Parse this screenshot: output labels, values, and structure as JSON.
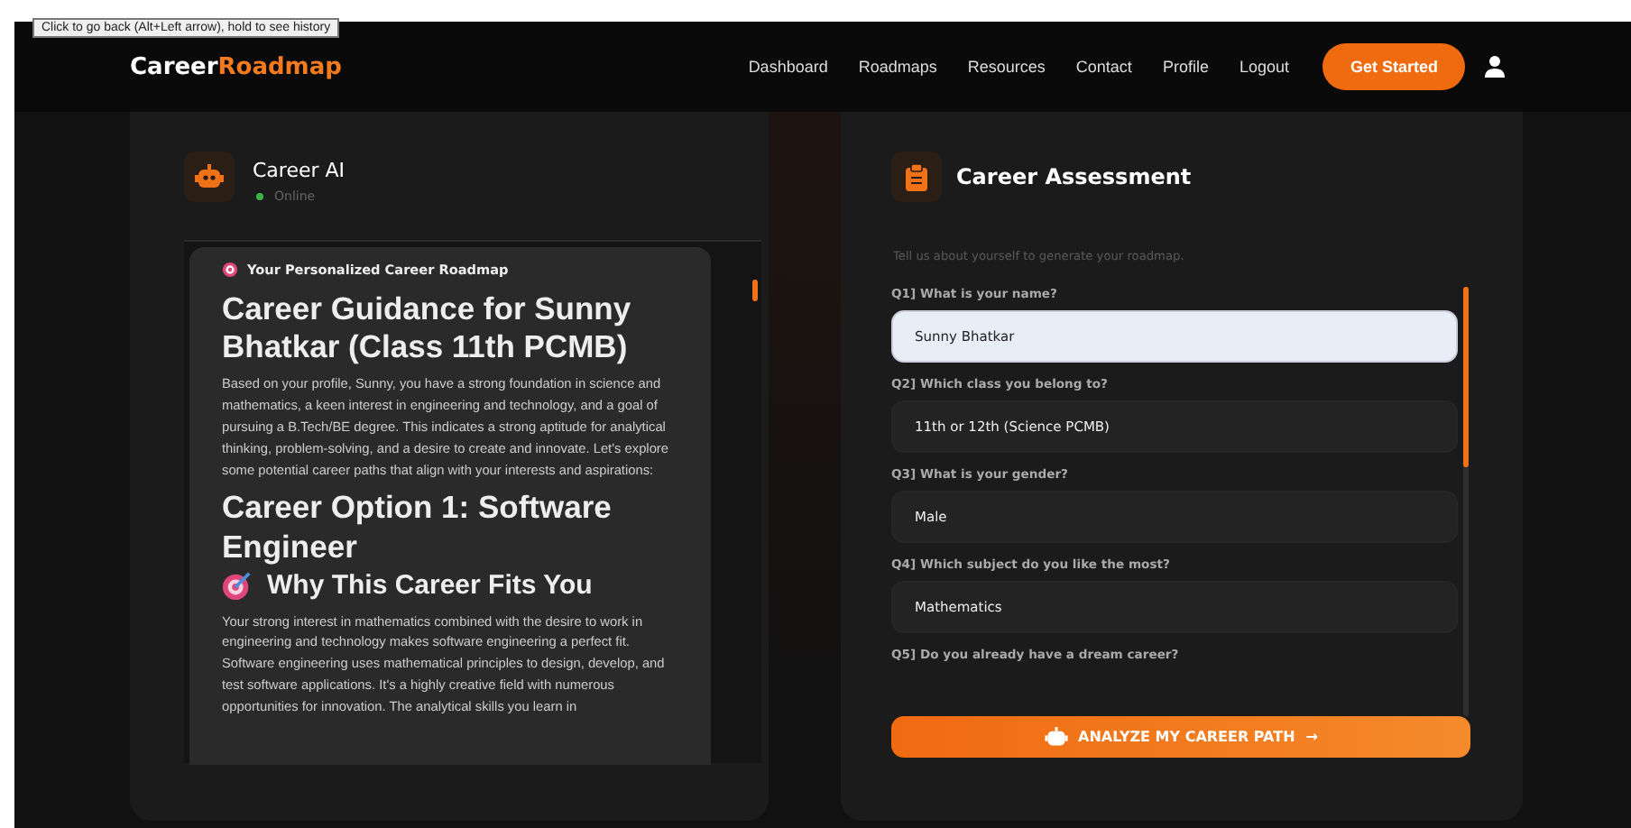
{
  "tooltip": "Click to go back (Alt+Left arrow), hold to see history",
  "logo": {
    "first": "Career",
    "second": "Roadmap"
  },
  "nav": [
    "Dashboard",
    "Roadmaps",
    "Resources",
    "Contact",
    "Profile",
    "Logout"
  ],
  "cta": "Get Started",
  "chat": {
    "title": "Career AI",
    "status": "Online",
    "online": true,
    "content": [
      {
        "kind": "label",
        "text": "Your Personalized Career Roadmap"
      },
      {
        "kind": "h1",
        "text": "Career Guidance for Sunny Bhatkar (Class 11th PCMB)"
      },
      {
        "kind": "p",
        "text": "Based on your profile, Sunny, you have a strong foundation in science and mathematics, a keen interest in engineering and technology, and a goal of pursuing a B.Tech/BE degree. This indicates a strong aptitude for analytical thinking, problem-solving, and a desire to create and innovate. Let's explore some potential career paths that align with your interests and aspirations:"
      },
      {
        "kind": "h2",
        "text": "Career Option 1: Software Engineer"
      },
      {
        "kind": "h3",
        "text": "Why This Career Fits You"
      },
      {
        "kind": "p",
        "text": "Your strong interest in mathematics combined with the desire to work in engineering and technology makes software engineering a perfect fit. Software engineering uses mathematical principles to design, develop, and test software applications. It's a highly creative field with numerous opportunities for innovation. The analytical skills you learn in"
      }
    ]
  },
  "form": {
    "title": "Career Assessment",
    "subtitle": "Tell us about yourself to generate your roadmap.",
    "questions": [
      {
        "label": "Q1] What is your name?",
        "value": "Sunny Bhatkar",
        "focused": true
      },
      {
        "label": "Q2] Which class you belong to?",
        "value": "11th or 12th (Science PCMB)",
        "focused": false
      },
      {
        "label": "Q3] What is your gender?",
        "value": "Male",
        "focused": false
      },
      {
        "label": "Q4] Which subject do you like the most?",
        "value": "Mathematics",
        "focused": false
      },
      {
        "label": "Q5] Do you already have a dream career?"
      }
    ],
    "button": "ANALYZE MY CAREER PATH",
    "button_arrow": "→"
  }
}
